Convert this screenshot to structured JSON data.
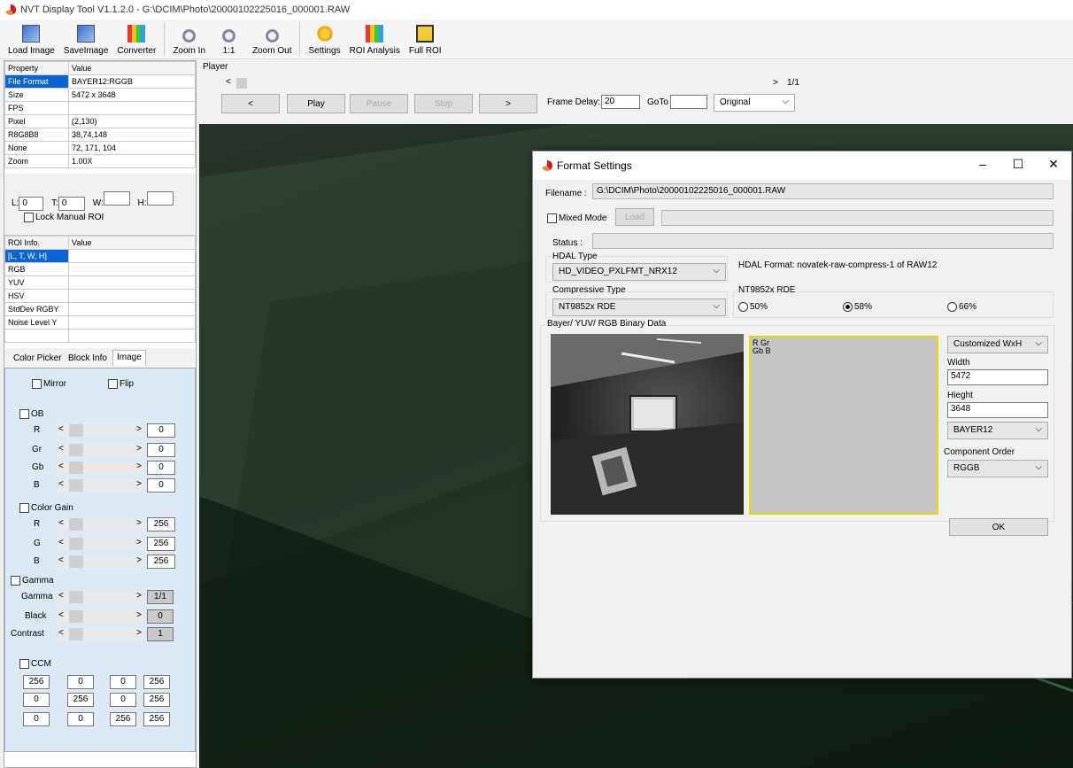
{
  "window": {
    "title": "NVT Display Tool V1.1.2.0 - G:\\DCIM\\Photo\\20000102225016_000001.RAW"
  },
  "toolbar": {
    "load_image": "Load Image",
    "save_image": "SaveImage",
    "converter": "Converter",
    "zoom_in": "Zoom In",
    "one_to_one": "1:1",
    "zoom_out": "Zoom Out",
    "settings": "Settings",
    "roi_analysis": "ROI Analysis",
    "full_roi": "Full ROI"
  },
  "props": {
    "hdr_property": "Property",
    "hdr_value": "Value",
    "rows": [
      {
        "k": "File Format",
        "v": "BAYER12:RGGB"
      },
      {
        "k": "Size",
        "v": "5472 x 3648"
      },
      {
        "k": "FPS",
        "v": ""
      },
      {
        "k": "Pixel",
        "v": "(2,130)"
      },
      {
        "k": "R8G8B8",
        "v": "38,74,148"
      },
      {
        "k": "None",
        "v": "72, 171, 104"
      },
      {
        "k": "Zoom",
        "v": "1.00X"
      }
    ]
  },
  "roi": {
    "l_label": "L:",
    "l_val": "0",
    "t_label": "T:",
    "t_val": "0",
    "w_label": "W:",
    "w_val": "",
    "h_label": "H:",
    "h_val": "",
    "lock_label": "Lock Manual ROI"
  },
  "roi_info": {
    "hdr_info": "ROI Info.",
    "hdr_value": "Value",
    "rows": [
      "[L, T, W, H]",
      "RGB",
      "YUV",
      "HSV",
      "StdDev RGBY",
      "Noise Level Y"
    ]
  },
  "tabs": {
    "color_picker": "Color Picker",
    "block_info": "Block Info",
    "image": "Image"
  },
  "image_panel": {
    "mirror": "Mirror",
    "flip": "Flip",
    "ob": "OB",
    "r": "R",
    "gr": "Gr",
    "gb": "Gb",
    "b": "B",
    "ob_vals": [
      "0",
      "0",
      "0",
      "0"
    ],
    "color_gain": "Color Gain",
    "g": "G",
    "gain_vals": [
      "256",
      "256",
      "256"
    ],
    "gamma_group": "Gamma",
    "gamma": "Gamma",
    "black": "Black",
    "contrast": "Contrast",
    "gamma_vals": [
      "1/1",
      "0",
      "1"
    ],
    "ccm": "CCM",
    "ccm_vals": [
      [
        "256",
        "0",
        "0",
        "256"
      ],
      [
        "0",
        "256",
        "0",
        "256"
      ],
      [
        "0",
        "0",
        "256",
        "256"
      ]
    ]
  },
  "player": {
    "label": "Player",
    "page": "1/1",
    "prev": "<",
    "play": "Play",
    "pause": "Pause",
    "stop": "Stop",
    "next": ">",
    "frame_delay_label": "Frame Delay:",
    "frame_delay": "20",
    "goto_label": "GoTo",
    "goto_val": "",
    "mode": "Original"
  },
  "dialog": {
    "title": "Format Settings",
    "filename_label": "Filename :",
    "filename": "G:\\DCIM\\Photo\\20000102225016_000001.RAW",
    "mixed_mode": "Mixed Mode",
    "load": "Load",
    "status_label": "Status :",
    "hdal_type_label": "HDAL Type",
    "hdal_type": "HD_VIDEO_PXLFMT_NRX12",
    "hdal_format": "HDAL Format: novatek-raw-compress-1 of RAW12",
    "compressive_label": "Compressive Type",
    "compressive": "NT9852x RDE",
    "rde_label": "NT9852x RDE",
    "rde_50": "50%",
    "rde_58": "58%",
    "rde_66": "66%",
    "binary_label": "Bayer/ YUV/ RGB Binary Data",
    "bayer_line1": "R  Gr",
    "bayer_line2": "Gb B",
    "size_mode": "Customized WxH",
    "width_label": "Width",
    "width": "5472",
    "height_label": "Hieght",
    "height": "3648",
    "format": "BAYER12",
    "order_label": "Component Order",
    "order": "RGGB",
    "ok": "OK"
  }
}
